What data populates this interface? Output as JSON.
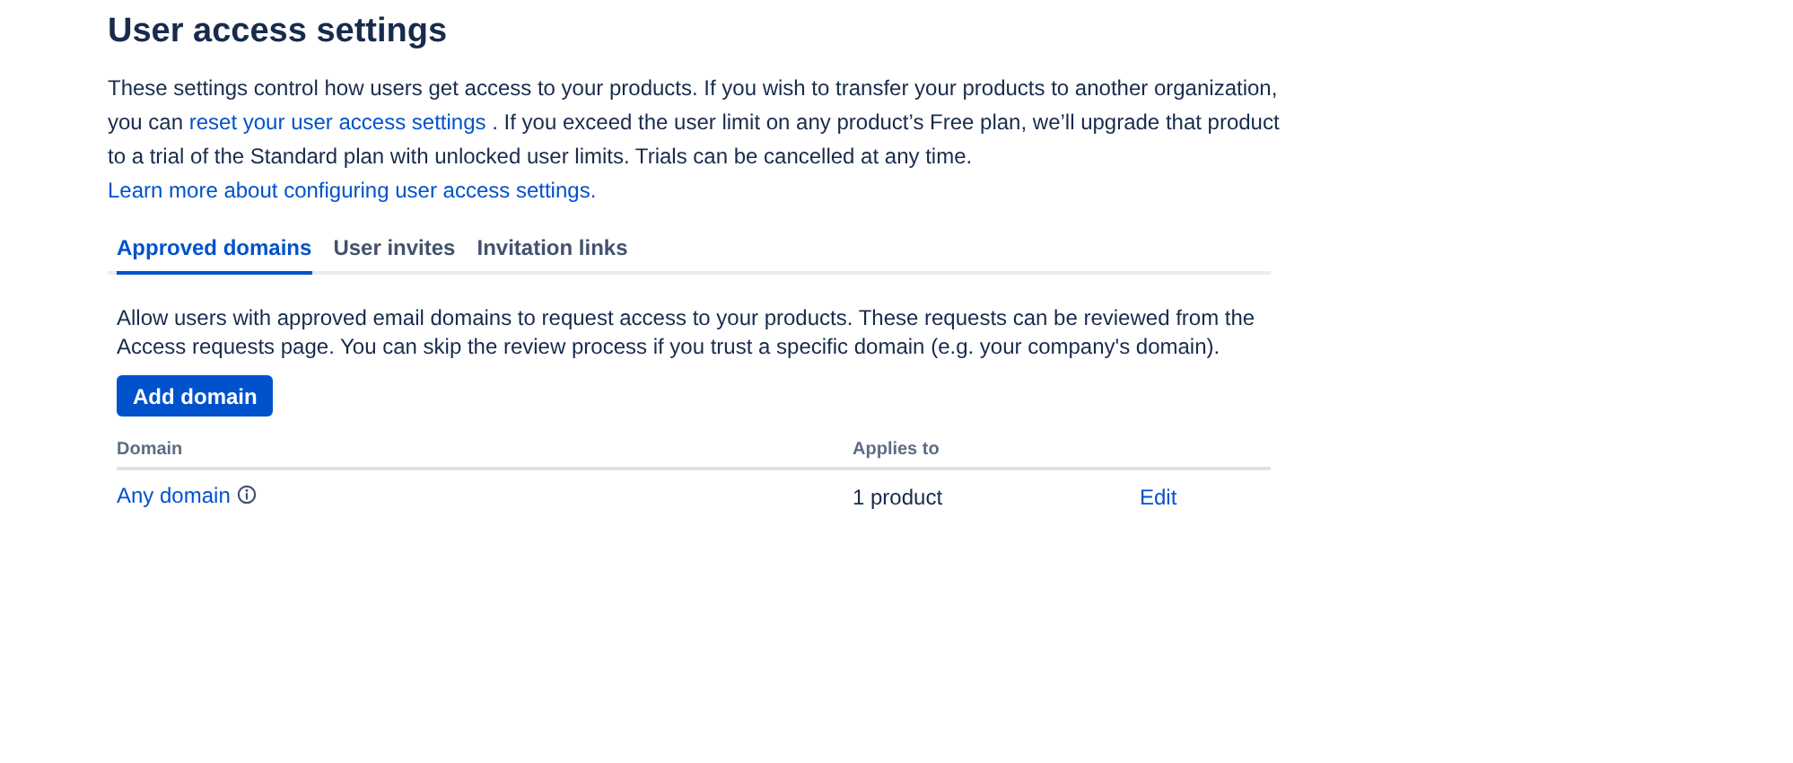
{
  "page": {
    "title": "User access settings"
  },
  "intro": [
    {
      "kind": "text",
      "text": "These settings control how users get access to your products. If you wish to transfer your products to another organization, you can"
    },
    {
      "kind": "link",
      "text": "reset your user access settings"
    },
    {
      "kind": "text",
      "text": ". If you exceed the user limit on any product’s Free plan, we’ll upgrade that product to a trial of the Standard plan with unlocked user limits. Trials can be cancelled at any time."
    },
    {
      "kind": "link",
      "text": "Learn more about configuring user access settings."
    }
  ],
  "tabs": [
    {
      "label": "Approved domains",
      "selected": true
    },
    {
      "label": "User invites",
      "selected": false
    },
    {
      "label": "Invitation links",
      "selected": false
    }
  ],
  "description": "Allow users with approved email domains to request access to your products. These requests can be reviewed from the Access requests page. You can skip the review process if you trust a specific domain (e.g. your company's domain).",
  "add_button": "Add domain",
  "table": {
    "columns": [
      "Domain",
      "Applies to"
    ],
    "rows": [
      {
        "domain": "Any domain",
        "info": true,
        "applies_to": "1 product",
        "action": "Edit"
      }
    ]
  }
}
